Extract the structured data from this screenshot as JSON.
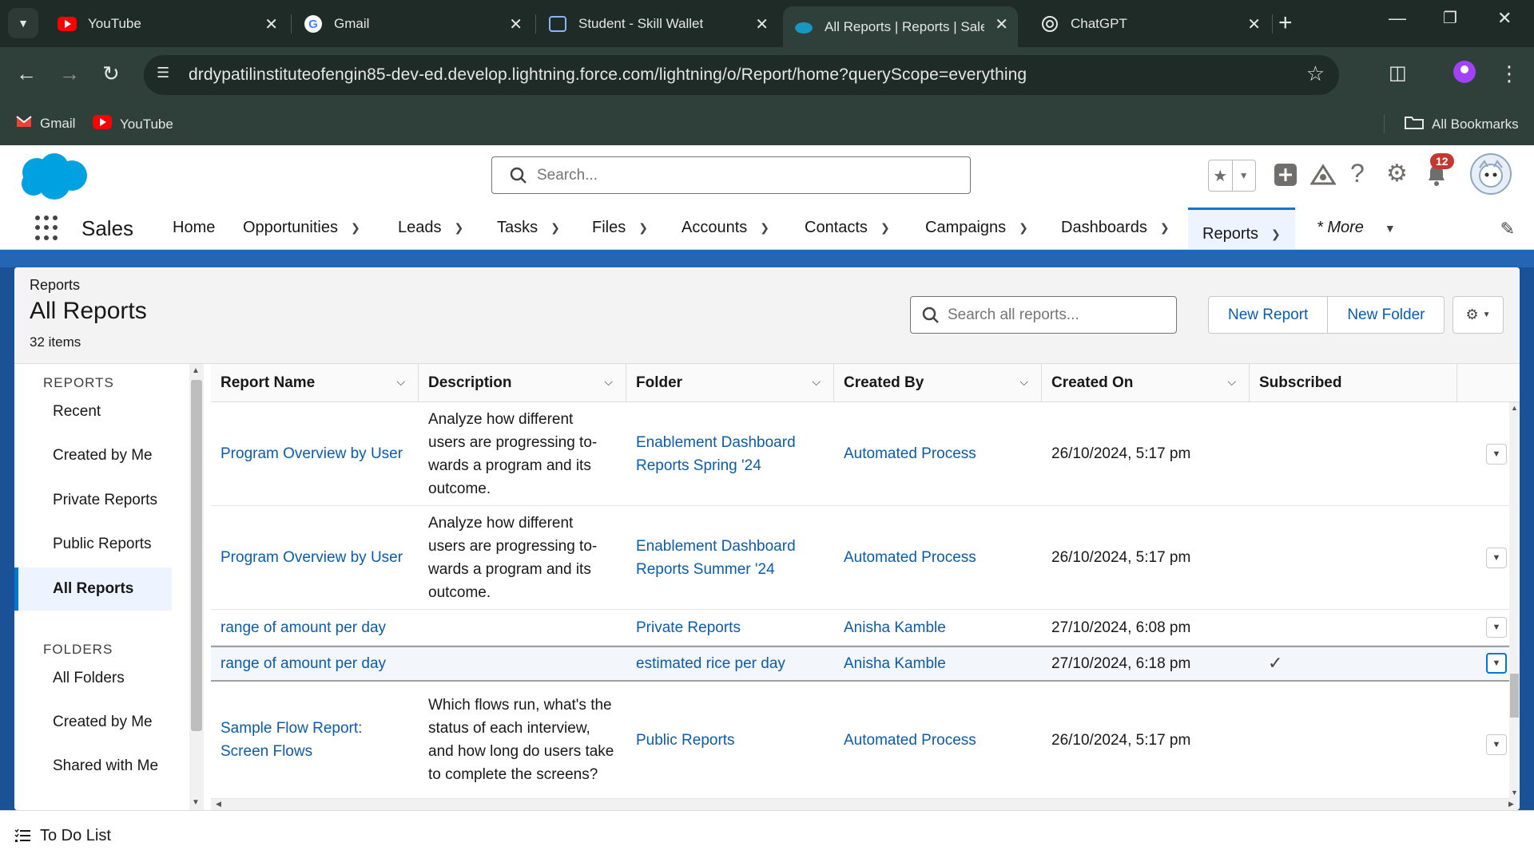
{
  "browser": {
    "tabs": [
      {
        "title": "YouTube",
        "icon": "youtube-icon"
      },
      {
        "title": "Gmail",
        "icon": "google-icon"
      },
      {
        "title": "Student - Skill Wallet",
        "icon": "skill-wallet-icon"
      },
      {
        "title": "All Reports | Reports | Sales",
        "icon": "salesforce-cloud-icon"
      },
      {
        "title": "ChatGPT",
        "icon": "chatgpt-icon"
      }
    ],
    "url": "drdypatilinstituteofengin85-dev-ed.develop.lightning.force.com/lightning/o/Report/home?queryScope=everything",
    "bookmarks": [
      {
        "label": "Gmail",
        "icon": "gmail-icon"
      },
      {
        "label": "YouTube",
        "icon": "youtube-icon"
      }
    ],
    "all_bookmarks": "All Bookmarks"
  },
  "sf": {
    "search_placeholder": "Search...",
    "notification_count": "12",
    "app_name": "Sales",
    "nav": [
      "Home",
      "Opportunities",
      "Leads",
      "Tasks",
      "Files",
      "Accounts",
      "Contacts",
      "Campaigns",
      "Dashboards",
      "Reports",
      "* More"
    ],
    "active_nav": "Reports",
    "accent": "#0176d3",
    "link_color": "#0b5cab"
  },
  "list": {
    "breadcrumb": "Reports",
    "title": "All Reports",
    "count": "32 items",
    "search_placeholder": "Search all reports...",
    "new_report": "New Report",
    "new_folder": "New Folder"
  },
  "leftnav": {
    "reports_heading": "REPORTS",
    "reports": [
      "Recent",
      "Created by Me",
      "Private Reports",
      "Public Reports",
      "All Reports"
    ],
    "folders_heading": "FOLDERS",
    "folders": [
      "All Folders",
      "Created by Me",
      "Shared with Me"
    ]
  },
  "table": {
    "columns": [
      "Report Name",
      "Description",
      "Folder",
      "Created By",
      "Created On",
      "Subscribed"
    ],
    "rows": [
      {
        "name": "Program Overview by User",
        "description": "Analyze how different users are progressing to-wards a program and its outcome.",
        "folder": "Enablement Dashboard Reports Spring '24",
        "created_by": "Automated Process",
        "created_on": "26/10/2024, 5:17 pm",
        "subscribed": false
      },
      {
        "name": "Program Overview by User",
        "description": "Analyze how different users are progressing to-wards a program and its outcome.",
        "folder": "Enablement Dashboard Reports Summer '24",
        "created_by": "Automated Process",
        "created_on": "26/10/2024, 5:17 pm",
        "subscribed": false
      },
      {
        "name": "range of amount per day",
        "description": "",
        "folder": "Private Reports",
        "created_by": "Anisha Kamble",
        "created_on": "27/10/2024, 6:08 pm",
        "subscribed": false
      },
      {
        "name": "range of amount per day",
        "description": "",
        "folder": "estimated rice per day",
        "created_by": "Anisha Kamble",
        "created_on": "27/10/2024, 6:18 pm",
        "subscribed": true
      },
      {
        "name": "Sample Flow Report: Screen Flows",
        "description": "Which flows run, what's the status of each interview, and how long do users take to complete the screens?",
        "folder": "Public Reports",
        "created_by": "Automated Process",
        "created_on": "26/10/2024, 5:17 pm",
        "subscribed": false
      }
    ]
  },
  "utility": {
    "todo": "To Do List"
  }
}
